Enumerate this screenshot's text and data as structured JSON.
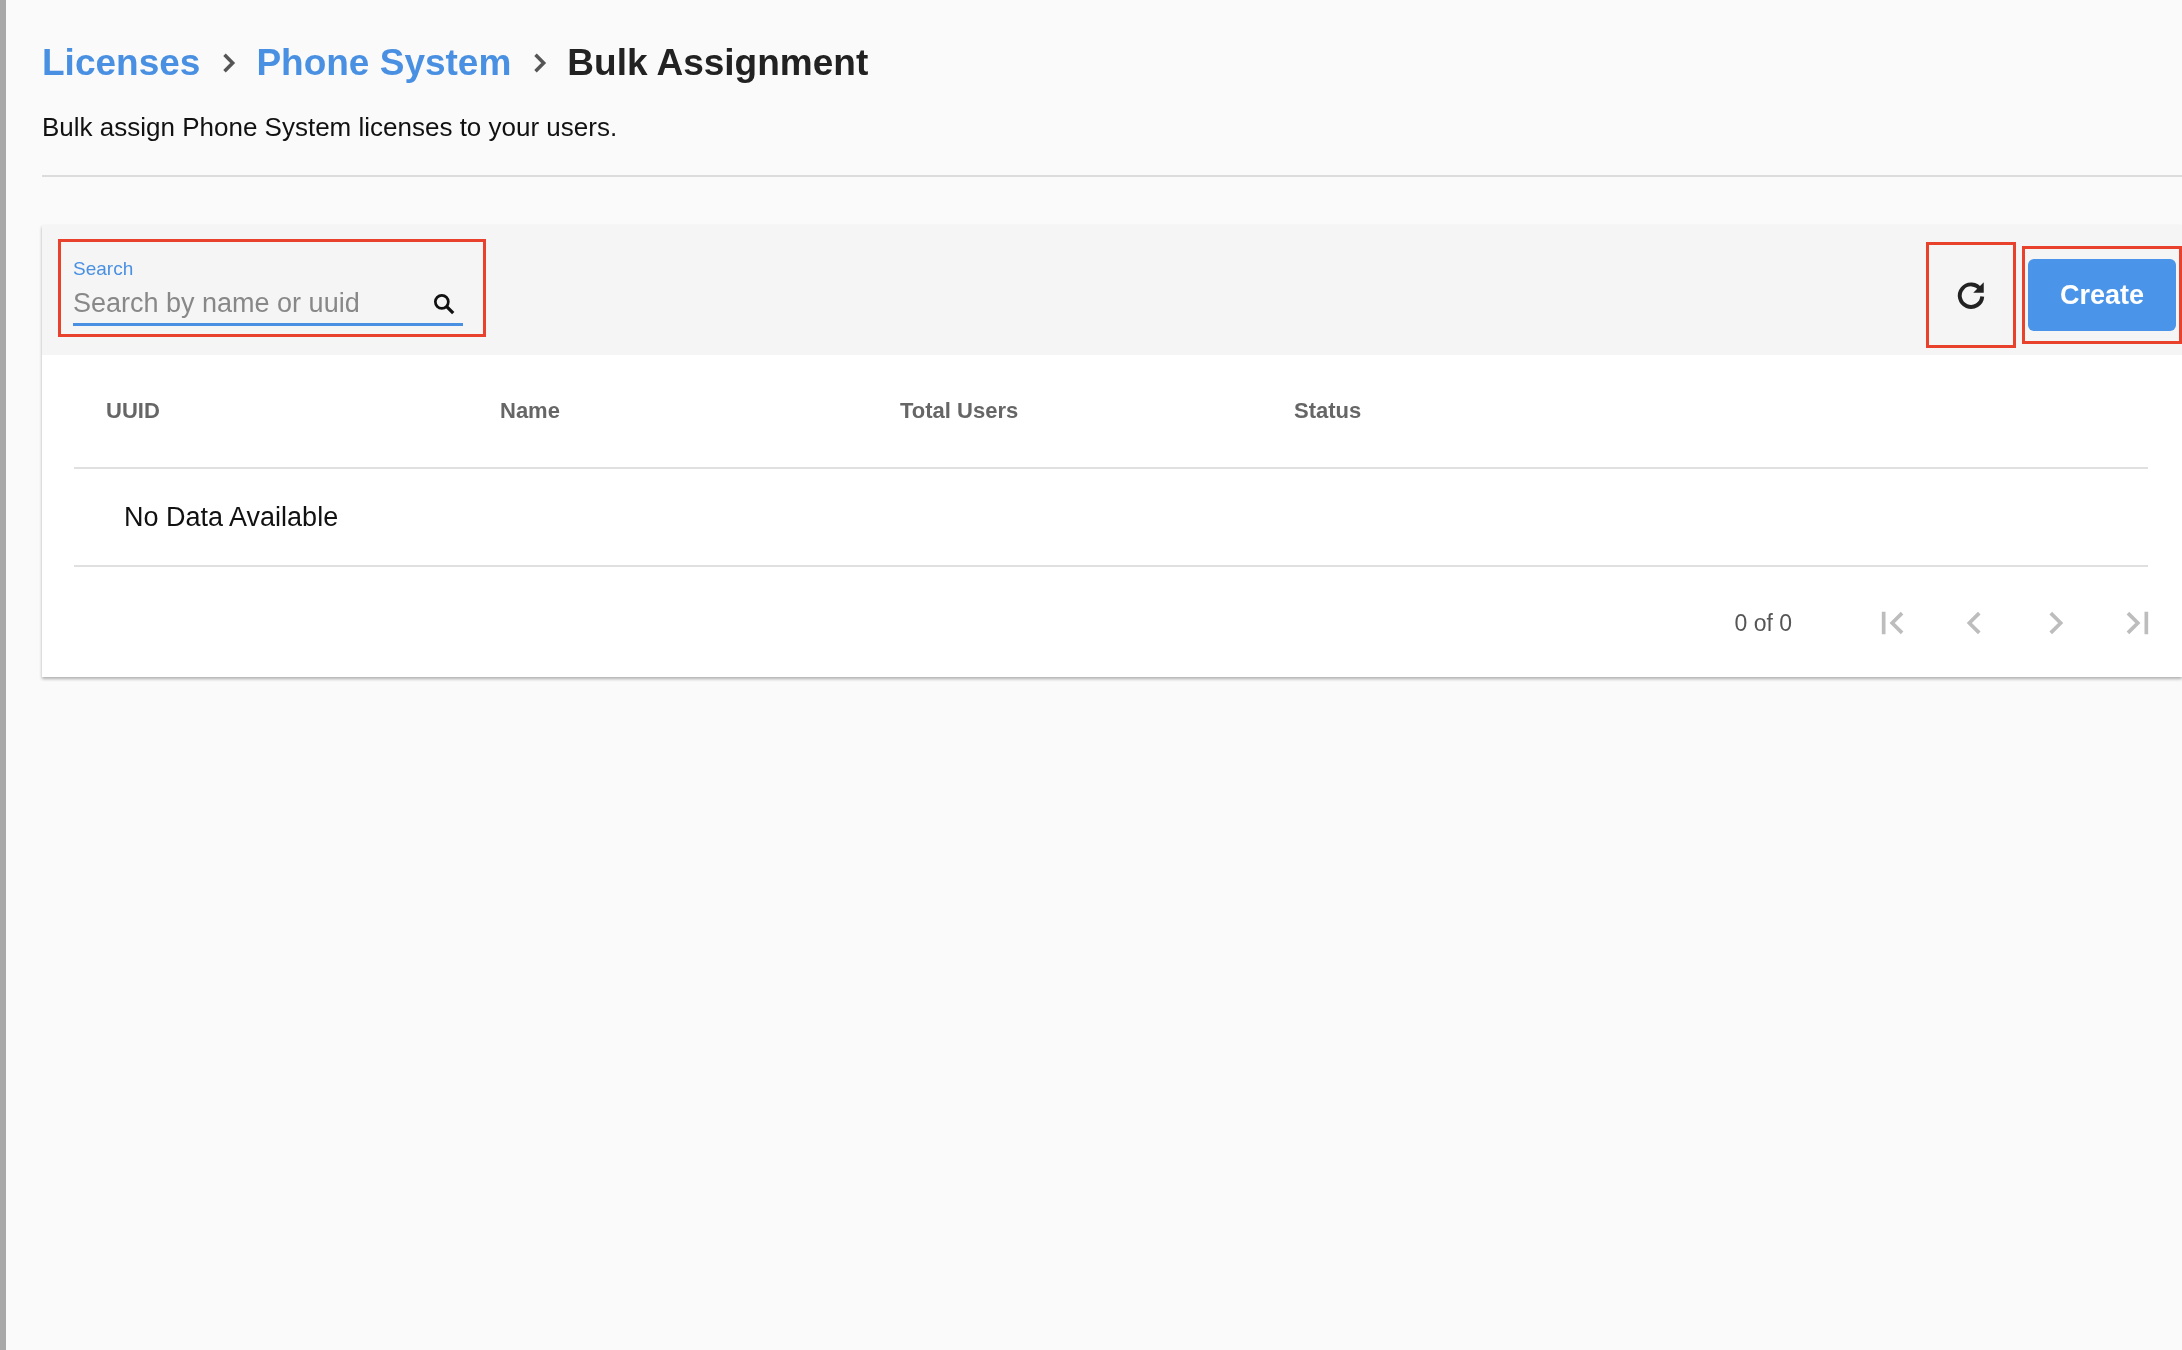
{
  "breadcrumb": [
    {
      "label": "Licenses",
      "kind": "link"
    },
    {
      "label": "Phone System",
      "kind": "link"
    },
    {
      "label": "Bulk Assignment",
      "kind": "current"
    }
  ],
  "description": "Bulk assign Phone System licenses to your users.",
  "toolbar": {
    "search": {
      "label": "Search",
      "placeholder": "Search by name or uuid",
      "highlighted": true
    },
    "refresh": {
      "highlighted": true
    },
    "create": {
      "label": "Create",
      "highlighted": true
    }
  },
  "table": {
    "columns": [
      "UUID",
      "Name",
      "Total Users",
      "Status"
    ],
    "empty_message": "No Data Available"
  },
  "pagination": {
    "range": "0 of 0",
    "buttons": [
      {
        "kind": "first",
        "disabled": true
      },
      {
        "kind": "prev",
        "disabled": true
      },
      {
        "kind": "next",
        "disabled": true
      },
      {
        "kind": "last",
        "disabled": true
      }
    ]
  }
}
